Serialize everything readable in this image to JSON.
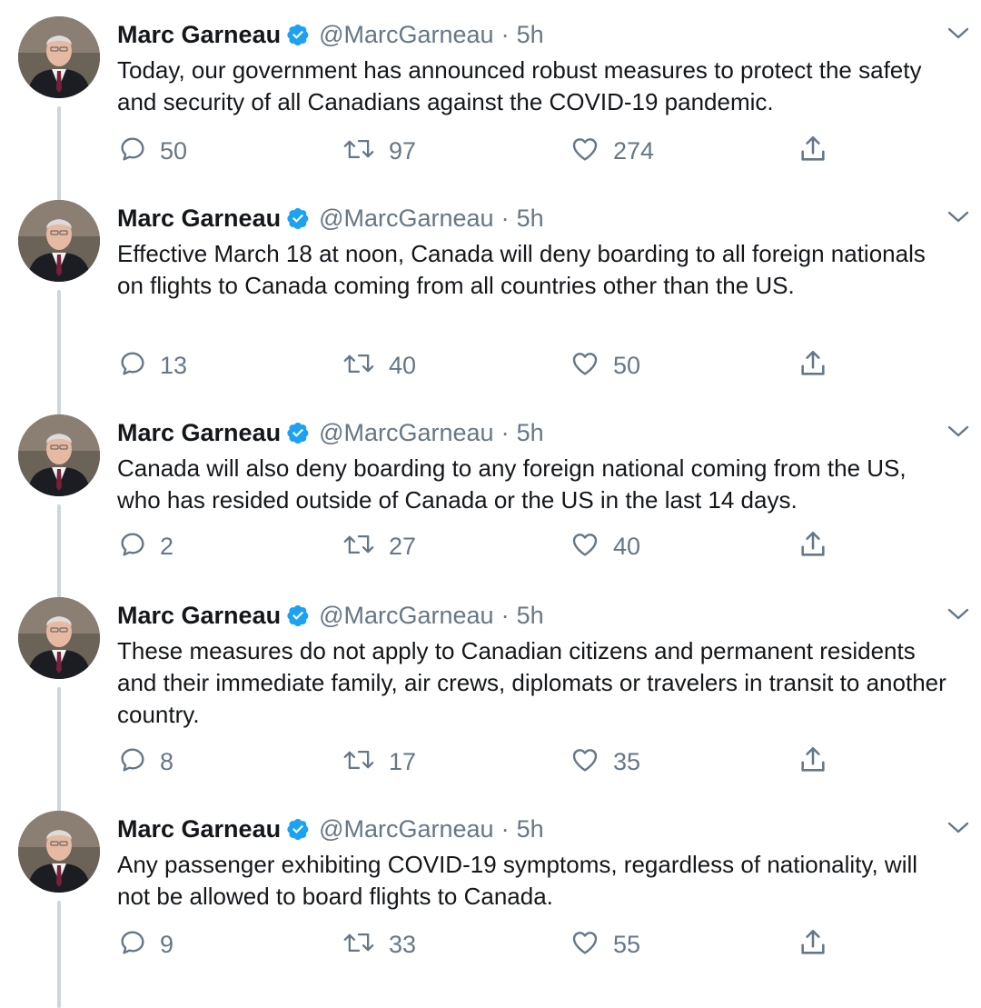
{
  "author": {
    "name": "Marc Garneau",
    "handle": "@MarcGarneau",
    "separator": "·",
    "time": "5h"
  },
  "icons": {
    "verified": "verified-badge-icon",
    "more": "chevron-down-icon",
    "reply": "reply-icon",
    "retweet": "retweet-icon",
    "like": "heart-icon",
    "share": "share-icon"
  },
  "colors": {
    "verified_blue": "#1da1f2",
    "text_primary": "#14171a",
    "text_secondary": "#657786",
    "thread_line": "#ccd6dd"
  },
  "tweets": [
    {
      "text": "Today, our government has announced robust measures to protect the safety and security of all Canadians against the COVID-19 pandemic.",
      "replies": "50",
      "retweets": "97",
      "likes": "274"
    },
    {
      "text": "Effective March 18 at noon, Canada will deny boarding to all foreign nationals on flights to Canada coming from all countries other than the US.",
      "replies": "13",
      "retweets": "40",
      "likes": "50"
    },
    {
      "text": "Canada will also deny boarding to any foreign national coming from the US, who has resided outside of Canada or the US in the last 14 days.",
      "replies": "2",
      "retweets": "27",
      "likes": "40"
    },
    {
      "text": "These measures do not apply to Canadian citizens and permanent residents and their immediate family, air crews, diplomats or travelers in transit to another country.",
      "replies": "8",
      "retweets": "17",
      "likes": "35"
    },
    {
      "text": "Any passenger exhibiting COVID-19 symptoms, regardless of nationality, will not be allowed to board flights to Canada.",
      "replies": "9",
      "retweets": "33",
      "likes": "55"
    }
  ]
}
